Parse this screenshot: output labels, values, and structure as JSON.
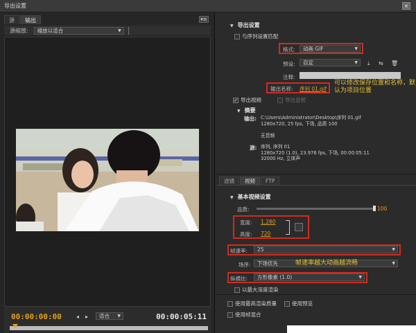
{
  "window": {
    "title": "导出设置",
    "close_label": "×"
  },
  "left": {
    "tabs": [
      "源",
      "输出"
    ],
    "panel_menu_label": "▾≡",
    "scale_label": "源缩放:",
    "scale_value": "缩放以适合",
    "transport": {
      "timecode_current": "00:00:00:00",
      "timecode_end": "00:00:05:11",
      "zoom_value": "适合",
      "step_back_label": "◂",
      "step_fwd_label": "▸"
    }
  },
  "export": {
    "section_title": "导出设置",
    "match_sequence_label": "与序列设置匹配",
    "format_label": "格式:",
    "format_value": "动画 GIF",
    "preset_label": "预设:",
    "preset_value": "自定",
    "comment_label": "注释:",
    "output_name_label": "输出名称:",
    "output_name_value": "序列 01.gif",
    "note_output": "可以修改保存位置和名称，默认为项目位置",
    "export_video_label": "导出视频",
    "export_audio_label": "导出音频"
  },
  "summary": {
    "title": "摘要",
    "output_label": "输出:",
    "output_text": "C:\\Users\\Administrator\\Desktop\\序列 01.gif\n1280x720, 25 fps, 下场, 品质 100\n\n无音频",
    "source_label": "源:",
    "source_text": "序列, 序列 01\n1280x720 (1.0), 23.976 fps, 下场, 00:00:05:11\n32000 Hz, 立体声"
  },
  "right_tabs": [
    "滤镜",
    "视频",
    "FTP"
  ],
  "video": {
    "section_title": "基本视频设置",
    "quality_label": "品质:",
    "quality_value": "100",
    "quality_fraction": 1.0,
    "width_label": "宽度:",
    "width_value": "1,280",
    "height_label": "高度:",
    "height_value": "720",
    "framerate_label": "帧速率:",
    "framerate_value": "25",
    "field_label": "场序:",
    "field_value": "下场优先",
    "note_framerate": "帧速率越大动画越流畅",
    "aspect_label": "纵横比:",
    "aspect_value": "方形像素 (1.0)",
    "max_depth_label": "以最大深度渲染"
  },
  "bottom_options": {
    "max_quality_label": "使用最高渲染质量",
    "use_preview_label": "使用预览",
    "frame_blend_label": "使用帧混合"
  },
  "colors": {
    "accent": "#e3a11b",
    "highlight_box": "#d42a1e",
    "note": "#e8c232"
  }
}
